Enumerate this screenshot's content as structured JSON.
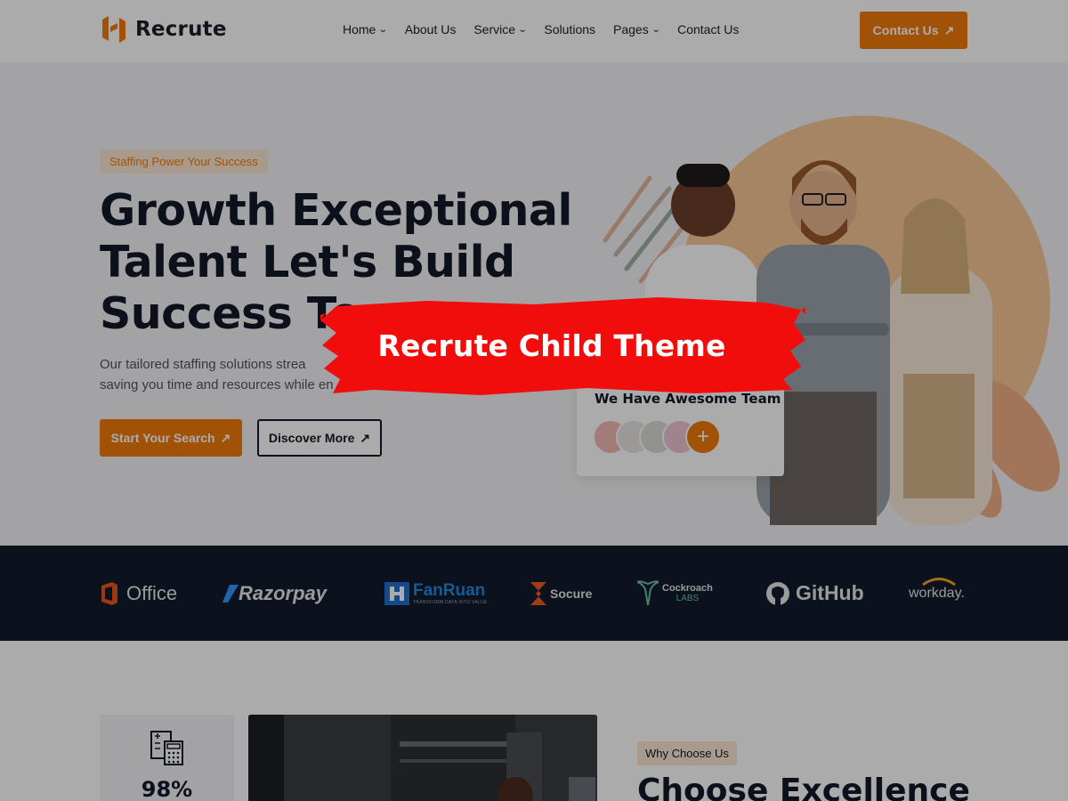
{
  "header": {
    "logo_text": "Recrute",
    "nav": [
      {
        "label": "Home",
        "has_dropdown": true
      },
      {
        "label": "About Us",
        "has_dropdown": false
      },
      {
        "label": "Service",
        "has_dropdown": true
      },
      {
        "label": "Solutions",
        "has_dropdown": false
      },
      {
        "label": "Pages",
        "has_dropdown": true
      },
      {
        "label": "Contact Us",
        "has_dropdown": false
      }
    ],
    "cta_label": "Contact Us",
    "cta_icon": "arrow-up-right-icon"
  },
  "hero": {
    "pill": "Staffing Power Your Success",
    "title_lines": [
      "Growth Exceptional",
      "Talent Let's Build",
      "Success To"
    ],
    "description_lines": [
      "Our tailored staffing solutions strea",
      "saving you time and resources while en"
    ],
    "primary_button": "Start Your Search",
    "secondary_button": "Discover More",
    "team_card_title": "We Have Awesome Team",
    "team_card_plus": "+"
  },
  "brands": [
    {
      "name": "Office",
      "icon": "office-icon"
    },
    {
      "name": "Razorpay",
      "icon": "razorpay-icon"
    },
    {
      "name": "FanRuan",
      "tagline": "TRANSFORM DATA INTO VALUE",
      "icon": "fanruan-icon"
    },
    {
      "name": "Socure",
      "icon": "socure-icon"
    },
    {
      "name": "Cockroach",
      "name2": "LABS",
      "icon": "cockroach-icon"
    },
    {
      "name": "GitHub",
      "icon": "github-icon"
    },
    {
      "name": "workday.",
      "icon": "workday-icon"
    }
  ],
  "features": {
    "stat_value": "98%",
    "stat_icon": "calculator-icon",
    "why_pill": "Why Choose Us",
    "why_title": "Choose Excellence"
  },
  "overlay": {
    "banner_text": "Recrute Child Theme"
  },
  "colors": {
    "accent": "#f07b0b",
    "dark": "#111827",
    "brand_bar": "#111b2e",
    "banner_red": "#f20d0d"
  }
}
